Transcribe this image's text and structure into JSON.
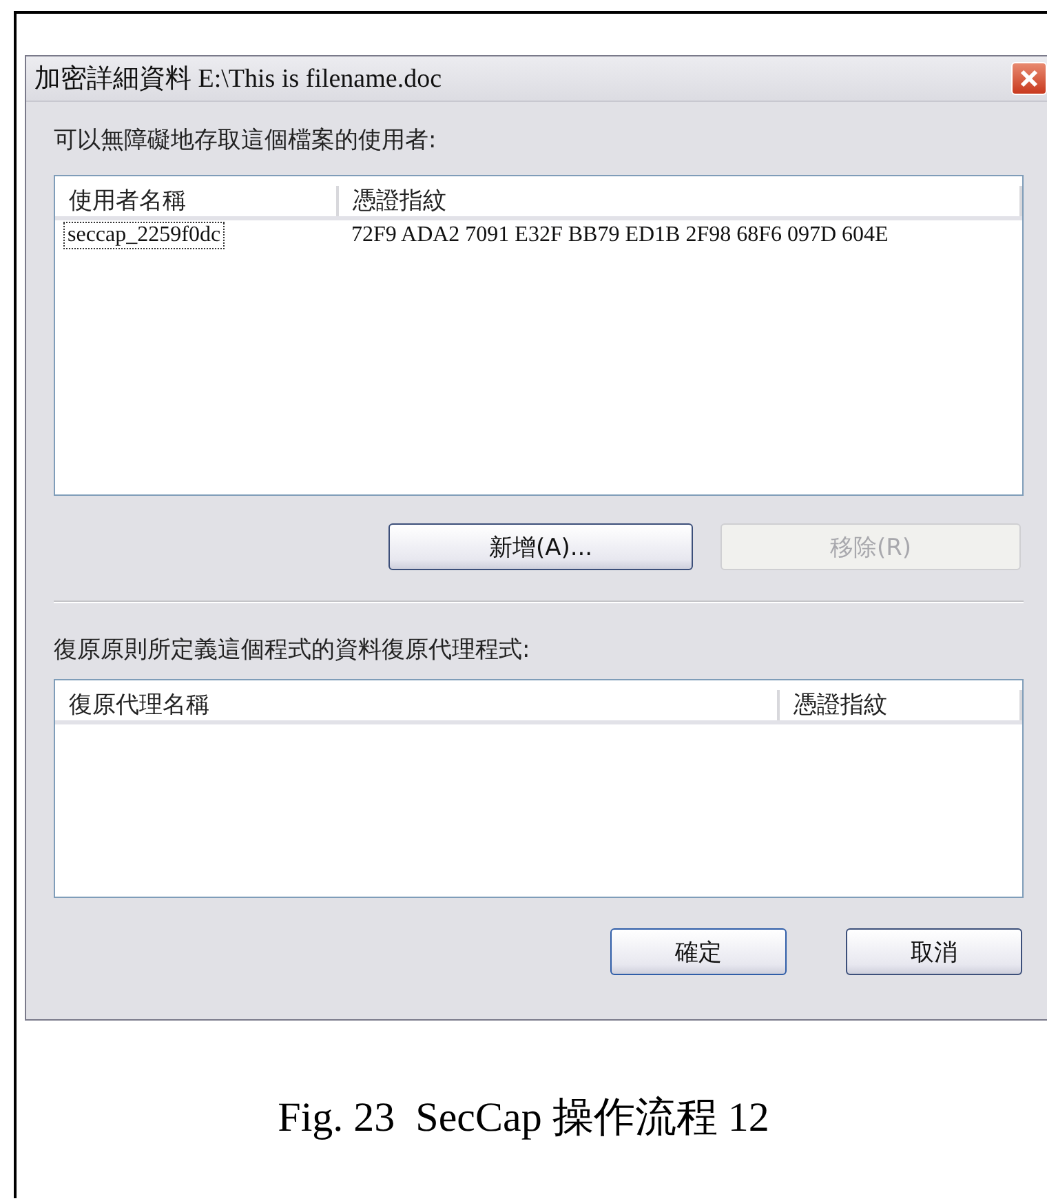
{
  "dialog": {
    "title": "加密詳細資料 E:\\This is filename.doc",
    "users_label": "可以無障礙地存取這個檔案的使用者:",
    "users_table": {
      "columns": [
        "使用者名稱",
        "憑證指紋"
      ],
      "rows": [
        {
          "cells": [
            "seccap_2259f0dc",
            "72F9 ADA2 7091 E32F BB79 ED1B 2F98 68F6 097D 604E"
          ],
          "focused": true
        }
      ]
    },
    "user_buttons": [
      {
        "label": "新增(A)...",
        "disabled": false
      },
      {
        "label": "移除(R)",
        "disabled": true
      }
    ],
    "agents_label": "復原原則所定義這個程式的資料復原代理程式:",
    "agents_table": {
      "columns": [
        "復原代理名稱",
        "憑證指紋"
      ]
    },
    "buttons": [
      {
        "label": "確定",
        "default": true
      },
      {
        "label": "取消",
        "default": false
      }
    ]
  },
  "caption": "Fig. 23  SecCap 操作流程 12"
}
